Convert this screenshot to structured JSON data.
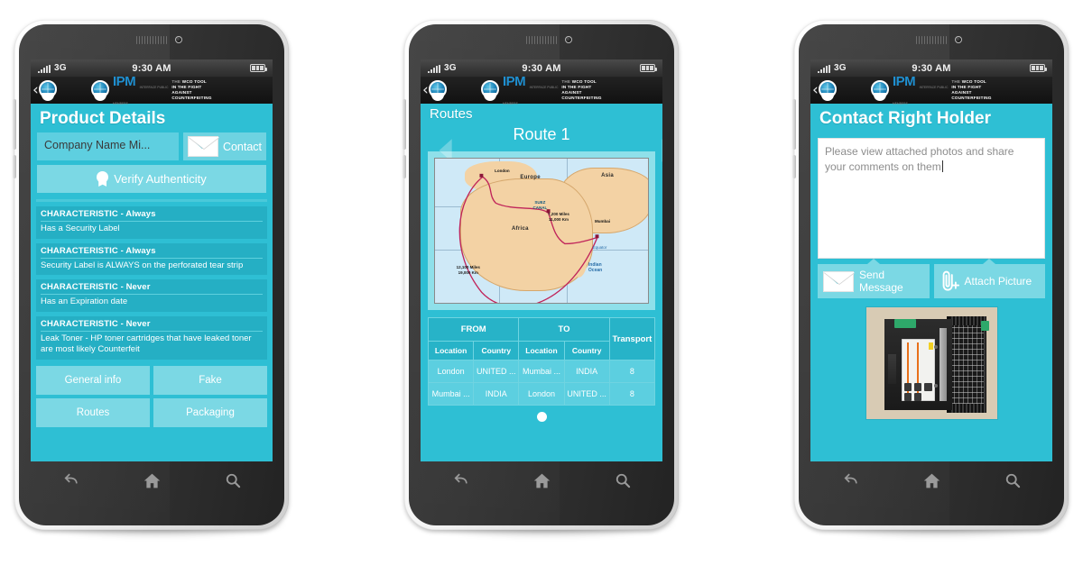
{
  "brand": {
    "accent": "#2ebfd4",
    "accent_light": "#7bd8e4",
    "accent_dark": "#25afc4",
    "logo_blue": "#1f8fd0",
    "ipm_word": "IPM",
    "ipm_sub": "INTERFACE PUBLIC MEMBERS",
    "tagline_line1_grey": "THE ",
    "tagline_line1_white": "WCO TOOL",
    "tagline_line2": "IN THE FIGHT AGAINST",
    "tagline_line3": "COUNTERFEITING",
    "back_chevron": "‹"
  },
  "statusbar": {
    "network": "3G",
    "time": "9:30 AM",
    "signal_icon": "signal-bars-icon",
    "battery_icon": "battery-full-icon"
  },
  "softkeys": {
    "back": "back-icon",
    "home": "home-icon",
    "search": "search-icon"
  },
  "phones": [
    {
      "id": "product-details",
      "title": "Product Details",
      "company_field": {
        "value": "Company Name Mi...",
        "placeholder": "Company Name"
      },
      "contact_button": {
        "label": "Contact",
        "icon": "envelope-icon"
      },
      "verify_button": {
        "label": "Verify Authenticity",
        "icon": "rosette-icon"
      },
      "characteristics": [
        {
          "heading": "CHARACTERISTIC - Always",
          "text": "Has a Security Label"
        },
        {
          "heading": "CHARACTERISTIC - Always",
          "text": "Security Label is ALWAYS on the perforated tear strip"
        },
        {
          "heading": "CHARACTERISTIC - Never",
          "text": "Has an Expiration date"
        },
        {
          "heading": "CHARACTERISTIC - Never",
          "text": "Leak Toner - HP toner cartridges that have leaked toner are most likely Counterfeit"
        }
      ],
      "tiles": [
        "General info",
        "Fake",
        "Routes",
        "Packaging"
      ]
    },
    {
      "id": "routes",
      "title": "Routes",
      "route_label": "Route 1",
      "prev_icon": "chevron-left-icon",
      "next_icon": "chevron-right-icon",
      "map": {
        "continents": [
          "Europe",
          "Asia",
          "Africa"
        ],
        "canal_label": "SUEZ CANAL",
        "city_labels": [
          "London",
          "Mumbai"
        ],
        "distance_short": "7,200 Miles\n11,000 Km",
        "distance_long": "12,100 Miles\n19,000 Km",
        "equator_label": "Equator",
        "ocean_label": "Indian\nOcean"
      },
      "table": {
        "group_headers": [
          "FROM",
          "TO",
          "Transport"
        ],
        "sub_headers": [
          "Location",
          "Country",
          "Location",
          "Country"
        ],
        "rows": [
          [
            "London",
            "UNITED ...",
            "Mumbai ...",
            "INDIA",
            "8"
          ],
          [
            "Mumbai ...",
            "INDIA",
            "London",
            "UNITED ...",
            "8"
          ]
        ]
      },
      "pager_dot": "page-indicator-dot"
    },
    {
      "id": "contact-right-holder",
      "title": "Contact Right Holder",
      "message": {
        "value": "Please view attached photos and share your comments on them",
        "placeholder": "Please view attached photos and share your comments on them"
      },
      "send_button": {
        "label_line1": "Send",
        "label_line2": "Message",
        "icon": "envelope-icon"
      },
      "attach_button": {
        "label": "Attach Picture",
        "icon": "paperclip-icon"
      },
      "attached_photo_alt": "toner-cartridge-photo"
    }
  ]
}
